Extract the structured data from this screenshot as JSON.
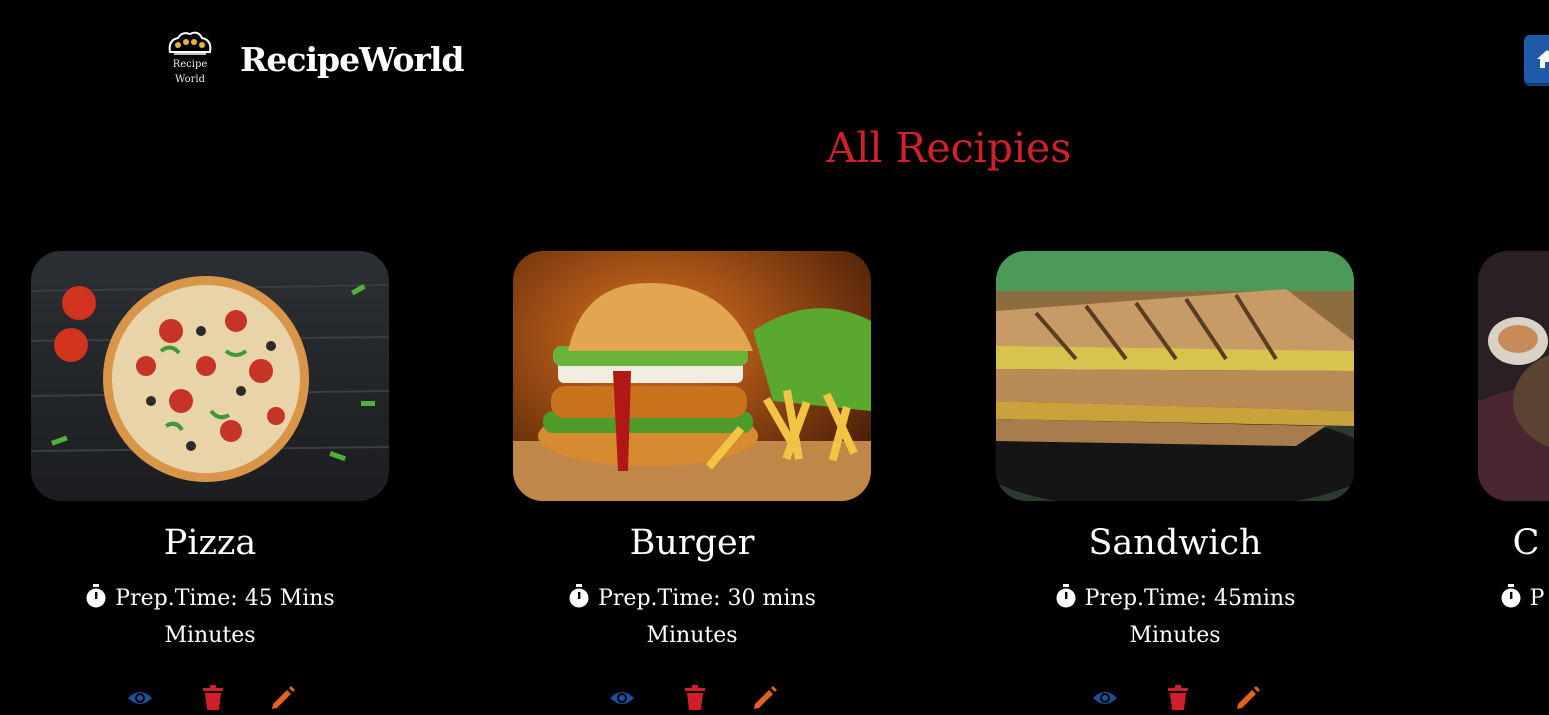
{
  "header": {
    "logo_text_top": "Recipe",
    "logo_text_bottom": "World",
    "brand_name": "RecipeWorld",
    "home_icon": "home-icon"
  },
  "main": {
    "title": "All Recipies"
  },
  "colors": {
    "background": "#000000",
    "title": "#d0202c",
    "view_icon": "#1e4f9a",
    "delete_icon": "#d01f2a",
    "edit_icon": "#e2641c",
    "home_button": "#1e5aa8"
  },
  "recipes": [
    {
      "name": "Pizza",
      "prep_label": "Prep.Time:",
      "prep_value": "45 Mins",
      "unit": "Minutes"
    },
    {
      "name": "Burger",
      "prep_label": "Prep.Time:",
      "prep_value": "30 mins",
      "unit": "Minutes"
    },
    {
      "name": "Sandwich",
      "prep_label": "Prep.Time:",
      "prep_value": "45mins",
      "unit": "Minutes"
    },
    {
      "name": "C",
      "prep_label": "P",
      "prep_value": "",
      "unit": ""
    }
  ],
  "card_icons": [
    "timer-icon",
    "eye-icon",
    "trash-icon",
    "pencil-icon"
  ]
}
